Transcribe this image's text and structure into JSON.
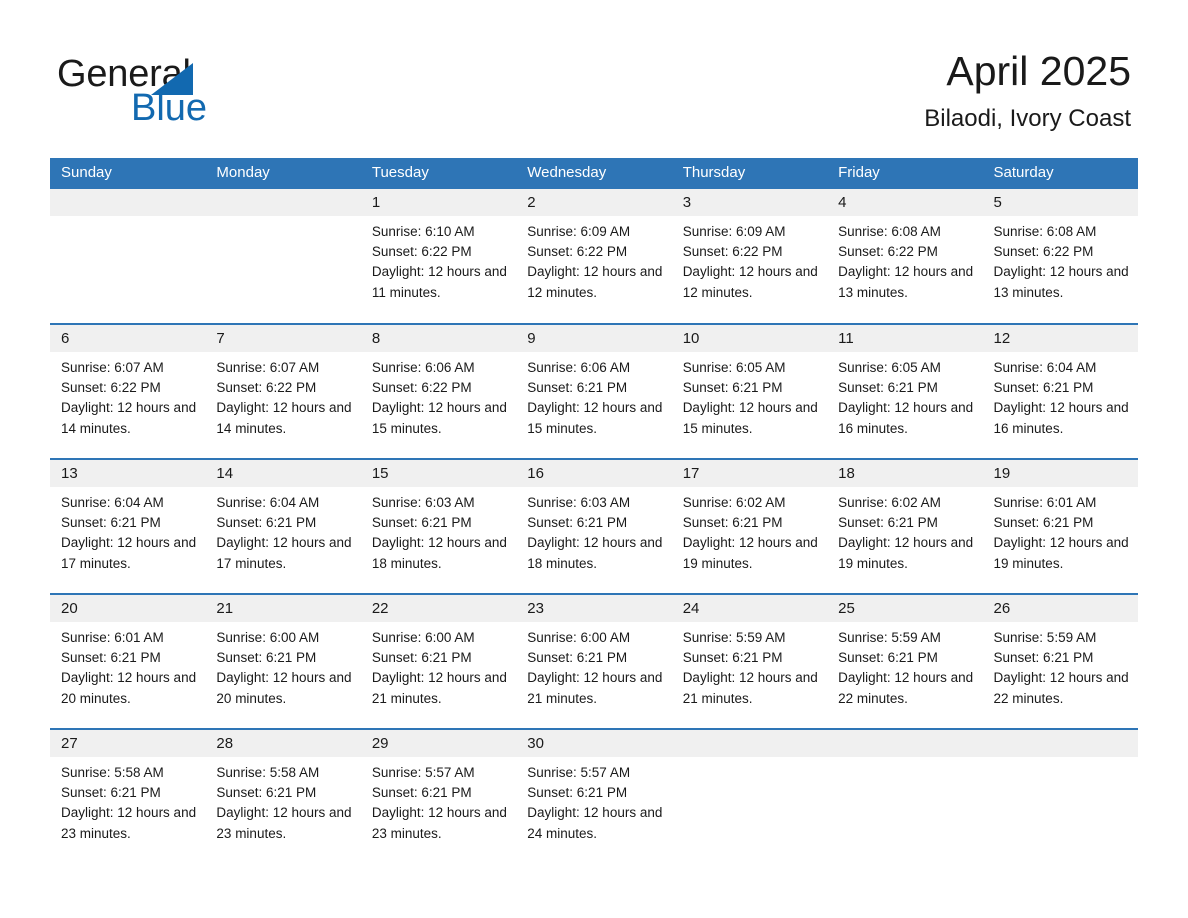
{
  "brand": {
    "name_part1": "General",
    "name_part2": "Blue",
    "accent_color": "#1269b0"
  },
  "header": {
    "title": "April 2025",
    "subtitle": "Bilaodi, Ivory Coast",
    "header_bg_color": "#2e75b6",
    "row_band_color": "#f0f0f0"
  },
  "weekday_headers": [
    "Sunday",
    "Monday",
    "Tuesday",
    "Wednesday",
    "Thursday",
    "Friday",
    "Saturday"
  ],
  "weeks": [
    [
      {
        "day": "",
        "blank": true,
        "sunrise": "",
        "sunset": "",
        "daylight": ""
      },
      {
        "day": "",
        "blank": true,
        "sunrise": "",
        "sunset": "",
        "daylight": ""
      },
      {
        "day": "1",
        "sunrise": "Sunrise: 6:10 AM",
        "sunset": "Sunset: 6:22 PM",
        "daylight": "Daylight: 12 hours and 11 minutes."
      },
      {
        "day": "2",
        "sunrise": "Sunrise: 6:09 AM",
        "sunset": "Sunset: 6:22 PM",
        "daylight": "Daylight: 12 hours and 12 minutes."
      },
      {
        "day": "3",
        "sunrise": "Sunrise: 6:09 AM",
        "sunset": "Sunset: 6:22 PM",
        "daylight": "Daylight: 12 hours and 12 minutes."
      },
      {
        "day": "4",
        "sunrise": "Sunrise: 6:08 AM",
        "sunset": "Sunset: 6:22 PM",
        "daylight": "Daylight: 12 hours and 13 minutes."
      },
      {
        "day": "5",
        "sunrise": "Sunrise: 6:08 AM",
        "sunset": "Sunset: 6:22 PM",
        "daylight": "Daylight: 12 hours and 13 minutes."
      }
    ],
    [
      {
        "day": "6",
        "sunrise": "Sunrise: 6:07 AM",
        "sunset": "Sunset: 6:22 PM",
        "daylight": "Daylight: 12 hours and 14 minutes."
      },
      {
        "day": "7",
        "sunrise": "Sunrise: 6:07 AM",
        "sunset": "Sunset: 6:22 PM",
        "daylight": "Daylight: 12 hours and 14 minutes."
      },
      {
        "day": "8",
        "sunrise": "Sunrise: 6:06 AM",
        "sunset": "Sunset: 6:22 PM",
        "daylight": "Daylight: 12 hours and 15 minutes."
      },
      {
        "day": "9",
        "sunrise": "Sunrise: 6:06 AM",
        "sunset": "Sunset: 6:21 PM",
        "daylight": "Daylight: 12 hours and 15 minutes."
      },
      {
        "day": "10",
        "sunrise": "Sunrise: 6:05 AM",
        "sunset": "Sunset: 6:21 PM",
        "daylight": "Daylight: 12 hours and 15 minutes."
      },
      {
        "day": "11",
        "sunrise": "Sunrise: 6:05 AM",
        "sunset": "Sunset: 6:21 PM",
        "daylight": "Daylight: 12 hours and 16 minutes."
      },
      {
        "day": "12",
        "sunrise": "Sunrise: 6:04 AM",
        "sunset": "Sunset: 6:21 PM",
        "daylight": "Daylight: 12 hours and 16 minutes."
      }
    ],
    [
      {
        "day": "13",
        "sunrise": "Sunrise: 6:04 AM",
        "sunset": "Sunset: 6:21 PM",
        "daylight": "Daylight: 12 hours and 17 minutes."
      },
      {
        "day": "14",
        "sunrise": "Sunrise: 6:04 AM",
        "sunset": "Sunset: 6:21 PM",
        "daylight": "Daylight: 12 hours and 17 minutes."
      },
      {
        "day": "15",
        "sunrise": "Sunrise: 6:03 AM",
        "sunset": "Sunset: 6:21 PM",
        "daylight": "Daylight: 12 hours and 18 minutes."
      },
      {
        "day": "16",
        "sunrise": "Sunrise: 6:03 AM",
        "sunset": "Sunset: 6:21 PM",
        "daylight": "Daylight: 12 hours and 18 minutes."
      },
      {
        "day": "17",
        "sunrise": "Sunrise: 6:02 AM",
        "sunset": "Sunset: 6:21 PM",
        "daylight": "Daylight: 12 hours and 19 minutes."
      },
      {
        "day": "18",
        "sunrise": "Sunrise: 6:02 AM",
        "sunset": "Sunset: 6:21 PM",
        "daylight": "Daylight: 12 hours and 19 minutes."
      },
      {
        "day": "19",
        "sunrise": "Sunrise: 6:01 AM",
        "sunset": "Sunset: 6:21 PM",
        "daylight": "Daylight: 12 hours and 19 minutes."
      }
    ],
    [
      {
        "day": "20",
        "sunrise": "Sunrise: 6:01 AM",
        "sunset": "Sunset: 6:21 PM",
        "daylight": "Daylight: 12 hours and 20 minutes."
      },
      {
        "day": "21",
        "sunrise": "Sunrise: 6:00 AM",
        "sunset": "Sunset: 6:21 PM",
        "daylight": "Daylight: 12 hours and 20 minutes."
      },
      {
        "day": "22",
        "sunrise": "Sunrise: 6:00 AM",
        "sunset": "Sunset: 6:21 PM",
        "daylight": "Daylight: 12 hours and 21 minutes."
      },
      {
        "day": "23",
        "sunrise": "Sunrise: 6:00 AM",
        "sunset": "Sunset: 6:21 PM",
        "daylight": "Daylight: 12 hours and 21 minutes."
      },
      {
        "day": "24",
        "sunrise": "Sunrise: 5:59 AM",
        "sunset": "Sunset: 6:21 PM",
        "daylight": "Daylight: 12 hours and 21 minutes."
      },
      {
        "day": "25",
        "sunrise": "Sunrise: 5:59 AM",
        "sunset": "Sunset: 6:21 PM",
        "daylight": "Daylight: 12 hours and 22 minutes."
      },
      {
        "day": "26",
        "sunrise": "Sunrise: 5:59 AM",
        "sunset": "Sunset: 6:21 PM",
        "daylight": "Daylight: 12 hours and 22 minutes."
      }
    ],
    [
      {
        "day": "27",
        "sunrise": "Sunrise: 5:58 AM",
        "sunset": "Sunset: 6:21 PM",
        "daylight": "Daylight: 12 hours and 23 minutes."
      },
      {
        "day": "28",
        "sunrise": "Sunrise: 5:58 AM",
        "sunset": "Sunset: 6:21 PM",
        "daylight": "Daylight: 12 hours and 23 minutes."
      },
      {
        "day": "29",
        "sunrise": "Sunrise: 5:57 AM",
        "sunset": "Sunset: 6:21 PM",
        "daylight": "Daylight: 12 hours and 23 minutes."
      },
      {
        "day": "30",
        "sunrise": "Sunrise: 5:57 AM",
        "sunset": "Sunset: 6:21 PM",
        "daylight": "Daylight: 12 hours and 24 minutes."
      },
      {
        "day": "",
        "blank": true,
        "sunrise": "",
        "sunset": "",
        "daylight": ""
      },
      {
        "day": "",
        "blank": true,
        "sunrise": "",
        "sunset": "",
        "daylight": ""
      },
      {
        "day": "",
        "blank": true,
        "sunrise": "",
        "sunset": "",
        "daylight": ""
      }
    ]
  ]
}
